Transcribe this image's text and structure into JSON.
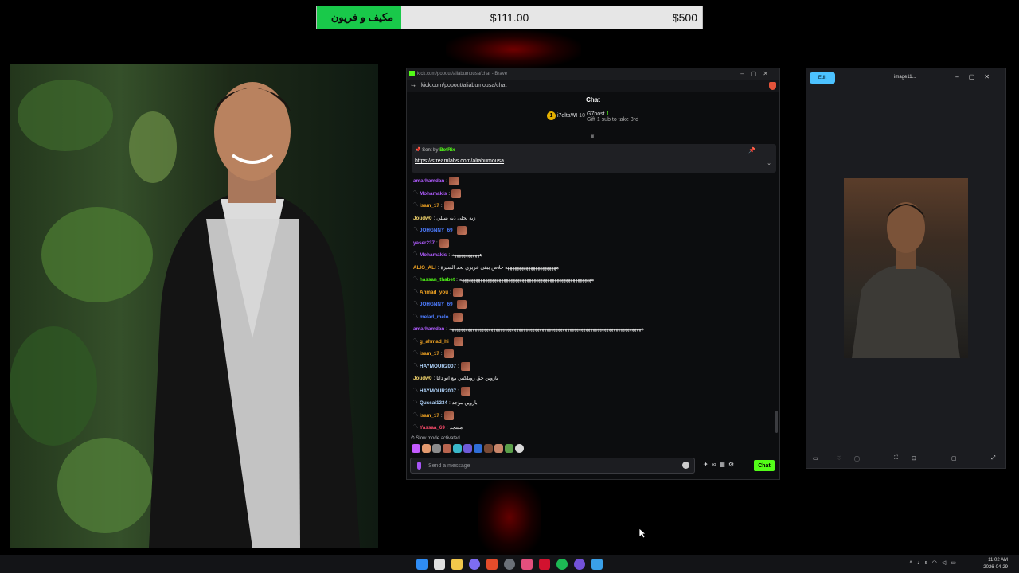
{
  "goal": {
    "label": "مكيف و فريون",
    "current": "$111.00",
    "target": "$500",
    "progress_fraction": 0.22,
    "fill_color": "#19c94a"
  },
  "browser": {
    "title": "kick.com/popout/aliabumousa/chat - Brave",
    "url": "kick.com/popout/aliabumousa/chat",
    "chat_title": "Chat"
  },
  "gifters": [
    {
      "name": "i7eltaWI",
      "count": "10",
      "rank": "1"
    },
    {
      "name": "G7host",
      "count": "1",
      "note": "Gift 1 sub to take 3rd"
    }
  ],
  "pinned": {
    "sent_by": "Sent by",
    "bot": "BotRix",
    "link": "https://streamlabs.com/aliabumousa"
  },
  "messages": [
    {
      "user": "amarhamdan",
      "color": "#b05cff",
      "text": "",
      "emote": true,
      "icon": false
    },
    {
      "user": "Mohamakis",
      "color": "#b05cff",
      "text": "",
      "emote": true,
      "icon": true
    },
    {
      "user": "isam_17",
      "color": "#f5a623",
      "text": "",
      "emote": true,
      "icon": true
    },
    {
      "user": "Joudw0",
      "color": "#f5d76e",
      "text": "زيه يحلى ذيه يسلي",
      "emote": false,
      "icon": false
    },
    {
      "user": "JOHGNNY_69",
      "color": "#4d7cff",
      "text": "",
      "emote": true,
      "icon": true
    },
    {
      "user": "yaser237",
      "color": "#b05cff",
      "text": "",
      "emote": true,
      "icon": false
    },
    {
      "user": "Mohamakis",
      "color": "#b05cff",
      "text": "ههههههههههههه",
      "emote": false,
      "icon": true
    },
    {
      "user": "ALIO_ALI",
      "color": "#f5a623",
      "text": "ههههههههههههههههههههههه خلاص يبقى عزيزي لحد السيرة",
      "emote": false,
      "icon": false
    },
    {
      "user": "hassan_thabet",
      "color": "#53fc18",
      "text": "هههههههههههههههههههههههههههههههههههههههههههههههههههههههههه",
      "emote": false,
      "icon": true
    },
    {
      "user": "Ahmad_you",
      "color": "#f5a623",
      "text": "",
      "emote": true,
      "icon": true
    },
    {
      "user": "JOHGNNY_69",
      "color": "#4d7cff",
      "text": "",
      "emote": true,
      "icon": true
    },
    {
      "user": "melad_melo",
      "color": "#4d7cff",
      "text": "",
      "emote": true,
      "icon": true
    },
    {
      "user": "amarhamdan",
      "color": "#b05cff",
      "text": "هههههههههههههههههههههههههههههههههههههههههههههههههههههههههههههههههههههههههههههههههههه",
      "emote": false,
      "icon": false
    },
    {
      "user": "g_ahmad_hi",
      "color": "#f5a623",
      "text": "",
      "emote": true,
      "icon": true
    },
    {
      "user": "isam_17",
      "color": "#f5a623",
      "text": "",
      "emote": true,
      "icon": true
    },
    {
      "user": "HAYMOUR2007",
      "color": "#b3d7ff",
      "text": "",
      "emote": true,
      "icon": true
    },
    {
      "user": "Joudw0",
      "color": "#f5d76e",
      "text": "بازوين حق روبلكس مع انو داتا",
      "emote": false,
      "icon": false
    },
    {
      "user": "HAYMOUR2007",
      "color": "#b3d7ff",
      "text": "",
      "emote": true,
      "icon": true
    },
    {
      "user": "Qussai1234",
      "color": "#b3d7ff",
      "text": "بازوين مؤجد",
      "emote": false,
      "icon": true
    },
    {
      "user": "isam_17",
      "color": "#f5a623",
      "text": "",
      "emote": true,
      "icon": true
    },
    {
      "user": "Yassaa_69",
      "color": "#ff4d6d",
      "text": "مسجد",
      "emote": false,
      "icon": true
    }
  ],
  "slow_mode": "Slow mode activated",
  "composer": {
    "placeholder": "Send a message",
    "send_label": "Chat"
  },
  "viewer": {
    "edit_label": "Edit",
    "filename": "image11..."
  },
  "clock": {
    "time": "11:02 AM",
    "date": "2026-04-29"
  },
  "colors": {
    "kick_green": "#53fc18",
    "accent_blue": "#4cc2ff"
  }
}
